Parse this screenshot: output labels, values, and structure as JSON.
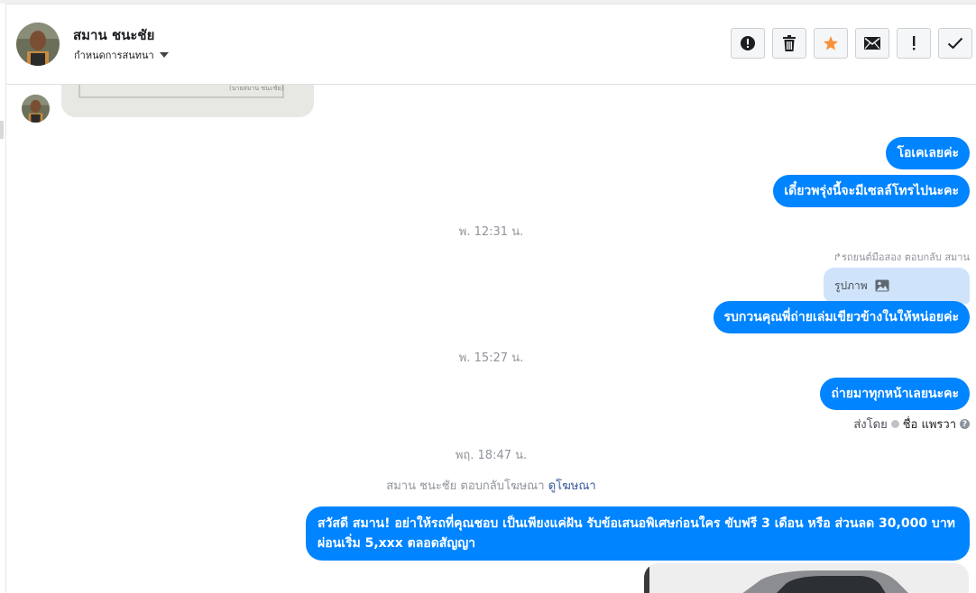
{
  "header": {
    "contact_name": "สมาน ชนะชัย",
    "subtitle": "กำหนดการสนทนา",
    "actions": [
      {
        "name": "mark-spam-button",
        "icon": "exclamation-circle-icon"
      },
      {
        "name": "delete-button",
        "icon": "trash-icon"
      },
      {
        "name": "star-button",
        "icon": "star-icon",
        "color": "#f7923a"
      },
      {
        "name": "mark-unread-button",
        "icon": "envelope-icon"
      },
      {
        "name": "important-button",
        "icon": "exclamation-icon"
      },
      {
        "name": "mark-done-button",
        "icon": "checkmark-icon"
      }
    ]
  },
  "chat": {
    "messages": {
      "m1": "โอเคเลยค่ะ",
      "m2": "เดี๋ยวพรุ่งนี้จะมีเซลล์โทรไปนะคะ",
      "m3": "รบกวนคุณพี่ถ่ายเล่มเขียวข้างในให้หน่อยค่ะ",
      "m4": "ถ่ายมาทุกหน้าเลยนะคะ",
      "m5": "สวัสดี สมาน! อย่าให้รถที่คุณชอบ เป็นเพียงแค่ฝัน รับข้อเสนอพิเศษก่อนใคร ขับฟรี 3 เดือน หรือ ส่วนลด 30,000 บาท ผ่อนเริ่ม 5,xxx ตลอดสัญญา"
    },
    "timestamps": {
      "t1": "พ. 12:31 น.",
      "t2": "พ. 15:27 น.",
      "t3": "พฤ. 18:47 น."
    },
    "reply_meta": "รถยนต์มือสอง ตอบกลับ สมาน",
    "reply_preview": {
      "label": "รูปภาพ",
      "icon": "image-icon"
    },
    "sent_by": {
      "prefix": "ส่งโดย",
      "name": "ชื่อ แพรวา"
    },
    "ad_reply": {
      "text": "สมาน ชนะชัย ตอบกลับโฆษณา",
      "link": "ดูโฆษณา"
    }
  },
  "colors": {
    "bubble_blue": "#0084ff",
    "reply_box": "#cfe4fb",
    "timestamp": "#90949c",
    "star": "#f7923a"
  }
}
